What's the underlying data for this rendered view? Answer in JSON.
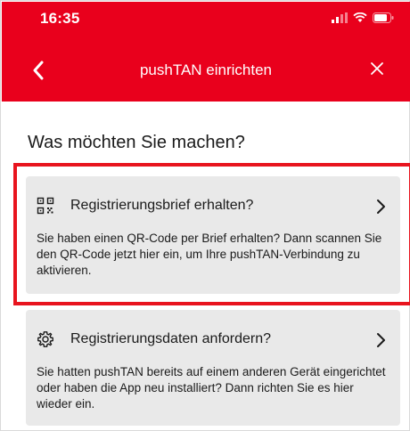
{
  "status_bar": {
    "time": "16:35"
  },
  "nav": {
    "title": "pushTAN einrichten"
  },
  "heading": "Was möchten Sie machen?",
  "options": [
    {
      "title": "Registrierungsbrief erhalten?",
      "description": "Sie haben einen QR-Code per Brief erhalten? Dann scannen Sie den QR-Code jetzt hier ein, um Ihre pushTAN-Verbindung zu aktivieren.",
      "icon": "qr-code-icon"
    },
    {
      "title": "Registrierungsdaten anfordern?",
      "description": "Sie hatten pushTAN bereits auf einem anderen Gerät eingerichtet oder haben die App neu installiert? Dann richten Sie es hier wieder ein.",
      "icon": "gear-icon"
    }
  ],
  "colors": {
    "brand": "#e9001c",
    "card_bg": "#e9e9e9",
    "highlight": "#e8141e"
  }
}
